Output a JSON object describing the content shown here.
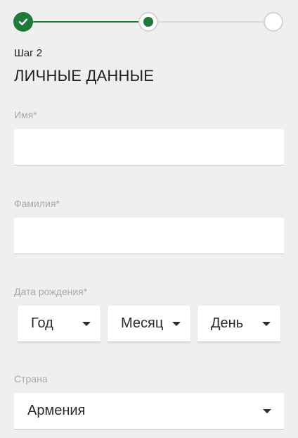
{
  "stepper": {
    "steps": [
      {
        "state": "done",
        "icon": "check-icon"
      },
      {
        "state": "current"
      },
      {
        "state": "upcoming"
      }
    ],
    "accent_color": "#1f7a3a"
  },
  "step_label": "Шаг 2",
  "section_title": "ЛИЧНЫЕ ДАННЫЕ",
  "fields": {
    "first_name": {
      "label": "Имя",
      "required_mark": "*",
      "value": ""
    },
    "last_name": {
      "label": "Фамилия",
      "required_mark": "*",
      "value": ""
    },
    "birth_date": {
      "label": "Дата рождения",
      "required_mark": "*",
      "year_placeholder": "Год",
      "month_placeholder": "Месяц",
      "day_placeholder": "День"
    },
    "country": {
      "label": "Страна",
      "value": "Армения"
    }
  }
}
